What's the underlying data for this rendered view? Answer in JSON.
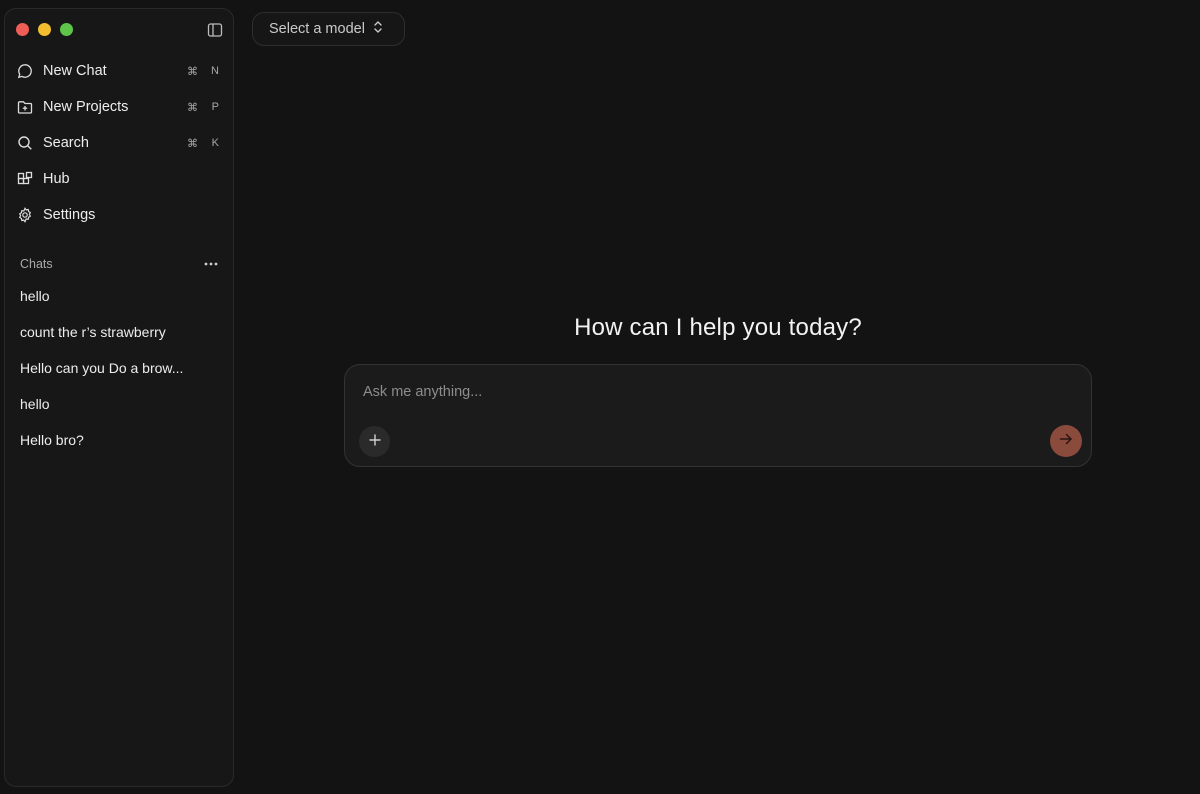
{
  "sidebar": {
    "nav": [
      {
        "label": "New Chat",
        "icon": "chat-bubble-icon",
        "shortcut_mod": "⌘",
        "shortcut_key": "N"
      },
      {
        "label": "New Projects",
        "icon": "folder-plus-icon",
        "shortcut_mod": "⌘",
        "shortcut_key": "P"
      },
      {
        "label": "Search",
        "icon": "search-icon",
        "shortcut_mod": "⌘",
        "shortcut_key": "K"
      },
      {
        "label": "Hub",
        "icon": "hub-icon"
      },
      {
        "label": "Settings",
        "icon": "gear-icon"
      }
    ],
    "chats_title": "Chats",
    "chats": [
      "hello",
      "count the r’s strawberry",
      "Hello can you Do a brow...",
      "hello",
      "Hello bro?"
    ]
  },
  "header": {
    "model_select_label": "Select a model"
  },
  "main": {
    "greeting": "How can I help you today?",
    "input_placeholder": "Ask me anything...",
    "input_value": ""
  },
  "colors": {
    "background": "#131313",
    "sidebar": "#171717",
    "send_button": "#8a4b3c",
    "traffic_red": "#ee5e57",
    "traffic_yellow": "#f2be30",
    "traffic_green": "#5ec54a"
  }
}
